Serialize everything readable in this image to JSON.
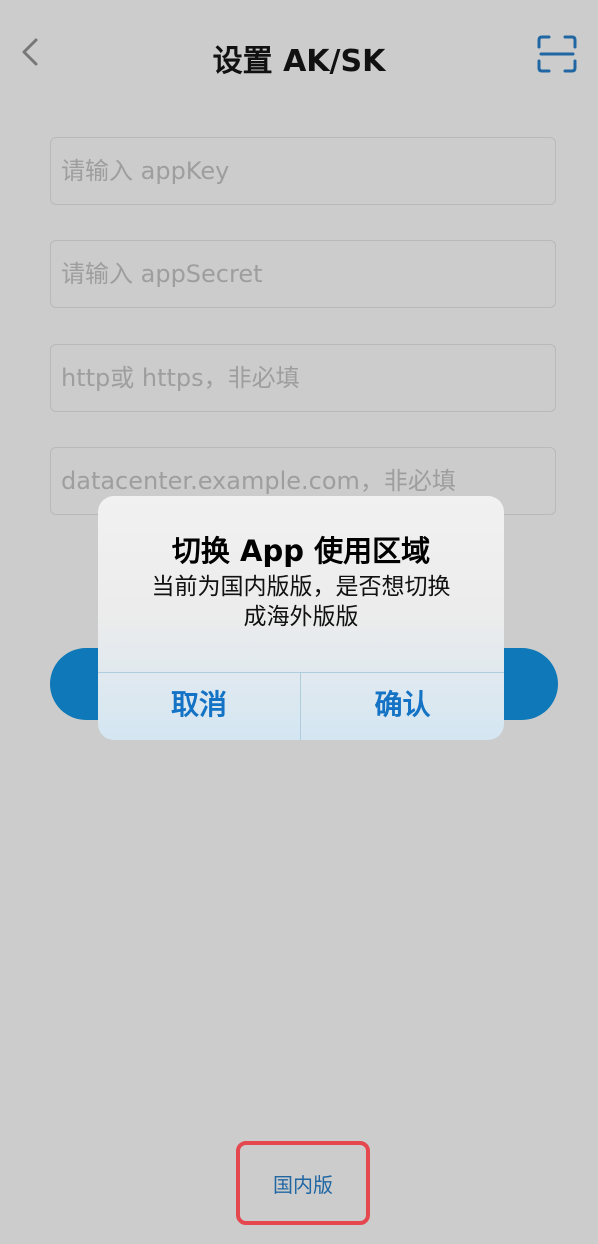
{
  "nav": {
    "title": "设置 AK/SK",
    "back_icon": "chevron-left-icon",
    "scan_icon": "scan-icon"
  },
  "form": {
    "app_key_placeholder": "请输入 appKey",
    "app_secret_placeholder": "请输入 appSecret",
    "protocol_placeholder": "http或 https，非必填",
    "host_placeholder": "datacenter.example.com，非必填",
    "submit_label": ""
  },
  "dialog": {
    "title": "切换 App 使用区域",
    "message_line1": "当前为国内版版，是否想切换",
    "message_line2": "成海外版版",
    "cancel_label": "取消",
    "confirm_label": "确认"
  },
  "footer": {
    "region_label": "国内版"
  },
  "colors": {
    "primary": "#0e78b8",
    "dialog_button_text": "#1473c5",
    "highlight_border": "#e5474f"
  }
}
